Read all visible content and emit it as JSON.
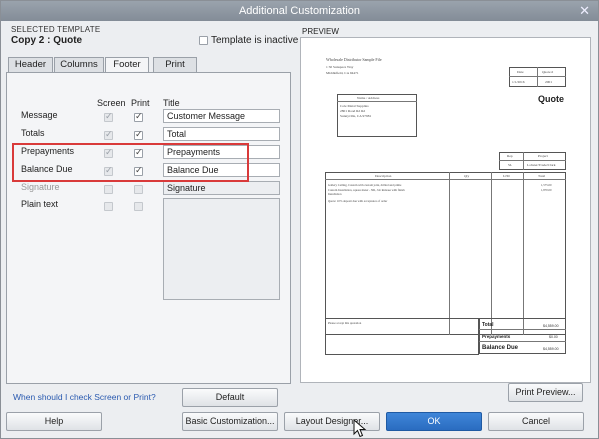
{
  "window": {
    "title": "Additional Customization"
  },
  "selected_template": {
    "label": "SELECTED TEMPLATE",
    "name": "Copy 2 : Quote"
  },
  "template_inactive": {
    "label": "Template is inactive",
    "checked": false
  },
  "tabs": [
    {
      "label": "Header"
    },
    {
      "label": "Columns"
    },
    {
      "label": "Footer",
      "active": true
    },
    {
      "label": "Print"
    }
  ],
  "footer_tab": {
    "col_screen": "Screen",
    "col_print": "Print",
    "col_title": "Title",
    "rows": [
      {
        "label": "Message",
        "screen": true,
        "print": true,
        "title": "Customer Message",
        "enabled": true
      },
      {
        "label": "Totals",
        "screen": true,
        "print": true,
        "title": "Total",
        "enabled": true
      },
      {
        "label": "Prepayments",
        "screen": true,
        "print": true,
        "title": "Prepayments",
        "enabled": true
      },
      {
        "label": "Balance Due",
        "screen": true,
        "print": true,
        "title": "Balance Due",
        "enabled": true
      },
      {
        "label": "Signature",
        "screen": false,
        "print": false,
        "title": "Signature",
        "enabled": false
      },
      {
        "label": "Plain text",
        "screen": false,
        "print": false,
        "title": "",
        "enabled": false
      }
    ]
  },
  "help_link": "When should I check Screen or Print?",
  "buttons": {
    "default": "Default",
    "help": "Help",
    "basic": "Basic Customization...",
    "layout": "Layout Designer...",
    "ok": "OK",
    "cancel": "Cancel",
    "print_preview": "Print Preview..."
  },
  "preview": {
    "label": "PREVIEW",
    "company": "Wholesale Distributor Sample File",
    "address1": "1 50 Sunspace Way",
    "address2": "Middlefield, CA 94471",
    "doc_title": "Quote",
    "date_hdr": "Date",
    "quote_hdr": "Quote #",
    "date_val": "1/1/2016",
    "quote_val": "2001",
    "name_addr_hdr": "Name / Address",
    "name_line1": "Cole Metal Supplies",
    "name_line2": "2801 Road Rd Rd",
    "name_line3": "Sunnyville, CA 97981",
    "rep_hdr": "Rep",
    "project_hdr": "Project",
    "rep_val": "SL",
    "project_val": "Lobster/Trade/Clark",
    "col_desc": "Description",
    "col_qty": "Qty",
    "col_um": "U/M",
    "col_total": "Total",
    "item1": "Gallery Ceiling, Custom with custom joint, drilled and prime",
    "item2": "Custom Installation, square meter - NR, Job Release with finish",
    "item3": "Installation",
    "item4": "Quote: 10% deposit due with acceptance of order",
    "amt1": "1,575.00",
    "amt2": "1,870.00",
    "footer_note": "Please accept this quotation",
    "total_label": "Total",
    "total_val": "$4,559.00",
    "prepay_label": "Prepayments",
    "prepay_val": "$0.00",
    "balance_label": "Balance Due",
    "balance_val": "$4,559.00"
  }
}
